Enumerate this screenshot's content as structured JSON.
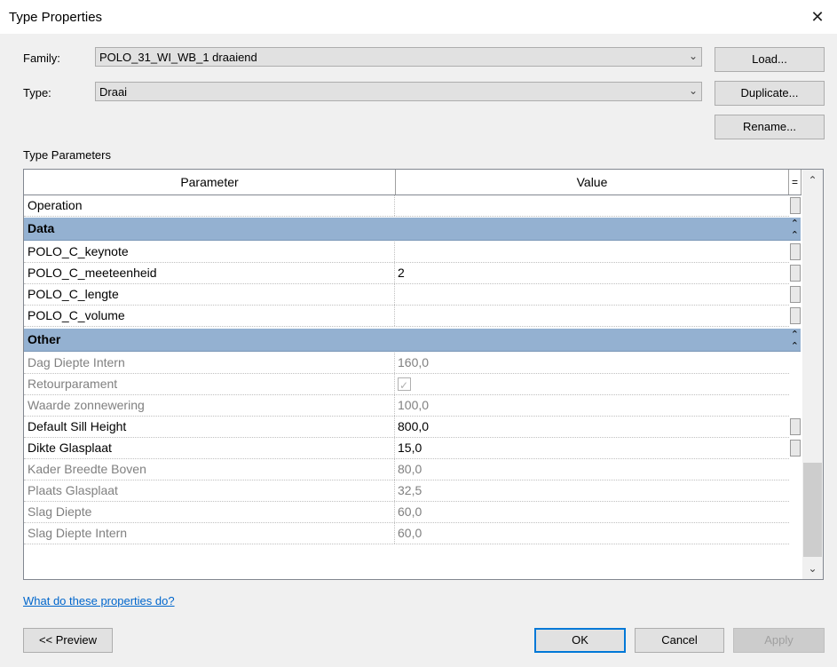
{
  "window": {
    "title": "Type Properties",
    "close_glyph": "✕"
  },
  "family": {
    "label": "Family:",
    "value": "POLO_31_WI_WB_1 draaiend"
  },
  "type": {
    "label": "Type:",
    "value": "Draai"
  },
  "buttons": {
    "load": "Load...",
    "duplicate": "Duplicate...",
    "rename": "Rename...",
    "preview": "<< Preview",
    "ok": "OK",
    "cancel": "Cancel",
    "apply": "Apply"
  },
  "section_label": "Type Parameters",
  "grid": {
    "headers": {
      "parameter": "Parameter",
      "value": "Value",
      "sort": "="
    },
    "rows_top": [
      {
        "name": "Operation",
        "value": ""
      }
    ],
    "groups": [
      {
        "name": "Data",
        "rows": [
          {
            "name": "POLO_C_keynote",
            "value": ""
          },
          {
            "name": "POLO_C_meeteenheid",
            "value": "2"
          },
          {
            "name": "POLO_C_lengte",
            "value": ""
          },
          {
            "name": "POLO_C_volume",
            "value": ""
          }
        ]
      },
      {
        "name": "Other",
        "rows": [
          {
            "name": "Dag Diepte Intern",
            "value": "160,0",
            "readonly": true
          },
          {
            "name": "Retourparament",
            "value": "checkbox",
            "readonly": true
          },
          {
            "name": "Waarde zonnewering",
            "value": "100,0",
            "readonly": true
          },
          {
            "name": "Default Sill Height",
            "value": "800,0"
          },
          {
            "name": "Dikte Glasplaat",
            "value": "15,0"
          },
          {
            "name": "Kader Breedte Boven",
            "value": "80,0",
            "readonly": true
          },
          {
            "name": "Plaats Glasplaat",
            "value": "32,5",
            "readonly": true
          },
          {
            "name": "Slag Diepte",
            "value": "60,0",
            "readonly": true
          },
          {
            "name": "Slag Diepte Intern",
            "value": "60,0",
            "readonly": true
          }
        ]
      }
    ]
  },
  "help_link": "What do these properties do?"
}
